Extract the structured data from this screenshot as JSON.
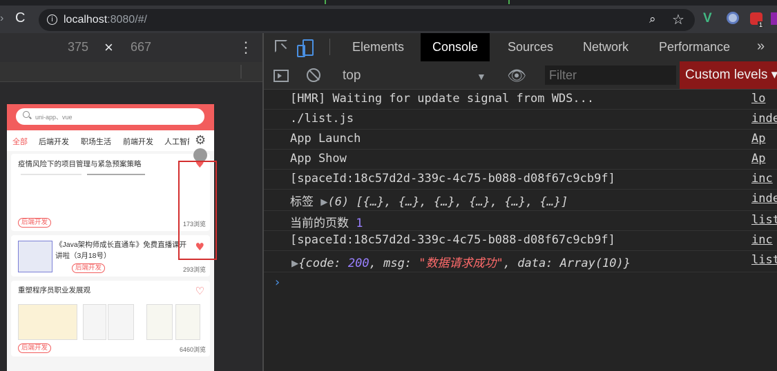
{
  "browser": {
    "url_host": "localhost",
    "url_rest": ":8080/#/"
  },
  "device_toolbar": {
    "width": "375",
    "times": "×",
    "height": "667"
  },
  "app": {
    "search_placeholder": "uni-app、vue",
    "categories": [
      "全部",
      "后端开发",
      "职场生活",
      "前端开发",
      "人工智能"
    ],
    "cards": [
      {
        "title": "疫情风险下的项目管理与紧急预案策略",
        "tag": "后端开发",
        "views": "173浏览"
      },
      {
        "title": "《Java架构师成长直通车》免费直播课开讲啦（3月18号）",
        "tag": "后端开发",
        "views": "293浏览"
      },
      {
        "title": "重塑程序员职业发展观",
        "tag": "后端开发",
        "views": "6460浏览"
      }
    ]
  },
  "devtools": {
    "tabs": [
      "Elements",
      "Console",
      "Sources",
      "Network",
      "Performance"
    ],
    "active_tab": "Console",
    "more": "»",
    "context": "top",
    "filter_placeholder": "Filter",
    "levels": "Custom levels ▾",
    "logs": [
      {
        "text": "[HMR] Waiting for update signal from WDS...",
        "src": "lo"
      },
      {
        "text": "./list.js",
        "src": "inde"
      },
      {
        "text": "App Launch",
        "src": "Ap"
      },
      {
        "text": "App Show",
        "src": "Ap"
      },
      {
        "text": "[spaceId:18c57d2d-339c-4c75-b088-d08f67c9cb9f]",
        "src": "inc"
      },
      {
        "label": "标签 ",
        "arrow": "▶",
        "text": "(6) [{…}, {…}, {…}, {…}, {…}, {…}]",
        "src": "index"
      },
      {
        "label": "当前的页数 ",
        "num": "1",
        "src": "list"
      },
      {
        "text": "[spaceId:18c57d2d-339c-4c75-b088-d08f67c9cb9f]",
        "src": "inc"
      },
      {
        "arrow": "▶",
        "open": "{code: ",
        "code": "200",
        "mid": ", msg: ",
        "msg": "\"数据请求成功\"",
        "end": ", data: Array(10)}",
        "src": "list"
      }
    ],
    "prompt": "›"
  }
}
